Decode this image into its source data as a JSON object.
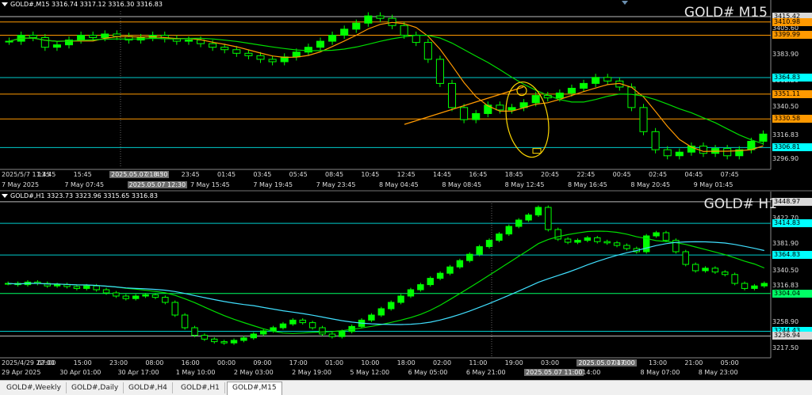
{
  "panels": [
    {
      "id": "m15",
      "info": "GOLD#,M15 3316.74 3317.12 3316.30 3316.83",
      "watermark": "GOLD# M15",
      "price_min": 3290,
      "price_max": 3420,
      "price_labels": [
        "3405.60",
        "3383.90",
        "3362.20",
        "3340.50",
        "3316.83",
        "3296.90"
      ],
      "tags": [
        {
          "value": "3415.42",
          "bg": "#d9d9d9",
          "fg": "#000"
        },
        {
          "value": "3410.98",
          "bg": "#ff9900",
          "fg": "#000"
        },
        {
          "value": "3399.99",
          "bg": "#ff9900",
          "fg": "#000"
        },
        {
          "value": "3364.83",
          "bg": "#00ffff",
          "fg": "#000"
        },
        {
          "value": "3351.11",
          "bg": "#ff9900",
          "fg": "#000"
        },
        {
          "value": "3330.58",
          "bg": "#ff9900",
          "fg": "#000"
        },
        {
          "value": "3306.81",
          "bg": "#00ffff",
          "fg": "#000"
        }
      ],
      "time_labels": [
        "2025/5/7 11:45",
        "13:45",
        "15:45",
        "2025.05.07 18:30",
        "21:45",
        "23:45",
        "01:45",
        "03:45",
        "05:45",
        "08:45",
        "10:45",
        "12:45",
        "14:45",
        "16:45",
        "18:45",
        "20:45",
        "22:45",
        "00:45",
        "02:45",
        "04:45",
        "07:45"
      ],
      "time_labels_2": [
        "7 May 2025",
        "7 May 07:45",
        "2025.05.07 12:30",
        "7 May 15:45",
        "7 May 19:45",
        "7 May 23:45",
        "8 May 04:45",
        "8 May 08:45",
        "8 May 12:45",
        "8 May 16:45",
        "8 May 20:45",
        "9 May 01:45"
      ],
      "price_series": [
        3395,
        3400,
        3398,
        3390,
        3392,
        3396,
        3400,
        3398,
        3401,
        3399,
        3396,
        3398,
        3400,
        3397,
        3395,
        3396,
        3393,
        3390,
        3388,
        3385,
        3383,
        3380,
        3378,
        3382,
        3386,
        3390,
        3395,
        3400,
        3405,
        3410,
        3416,
        3414,
        3408,
        3400,
        3394,
        3380,
        3360,
        3340,
        3330,
        3335,
        3342,
        3338,
        3340,
        3344,
        3350,
        3348,
        3352,
        3356,
        3360,
        3365,
        3362,
        3357,
        3340,
        3320,
        3305,
        3300,
        3303,
        3308,
        3302,
        3306,
        3300,
        3305,
        3312,
        3318
      ]
    },
    {
      "id": "h1",
      "info": "GOLD#,H1 3323.73 3323.96 3315.65 3316.83",
      "watermark": "GOLD# H1",
      "price_min": 3205,
      "price_max": 3450,
      "price_labels": [
        "3422.70",
        "3381.90",
        "3340.50",
        "3316.83",
        "3258.90",
        "3217.50"
      ],
      "tags": [
        {
          "value": "3448.97",
          "bg": "#d9d9d9",
          "fg": "#000"
        },
        {
          "value": "3414.83",
          "bg": "#00ffff",
          "fg": "#000"
        },
        {
          "value": "3364.83",
          "bg": "#00ffff",
          "fg": "#000"
        },
        {
          "value": "3304.04",
          "bg": "#00ff66",
          "fg": "#000"
        },
        {
          "value": "3244.43",
          "bg": "#00ffff",
          "fg": "#000"
        },
        {
          "value": "3236.94",
          "bg": "#d9d9d9",
          "fg": "#000"
        }
      ],
      "time_labels": [
        "2025/4/29 22:00",
        "07:00",
        "15:00",
        "23:00",
        "08:00",
        "16:00",
        "00:00",
        "09:00",
        "17:00",
        "01:00",
        "10:00",
        "18:00",
        "02:00",
        "11:00",
        "19:00",
        "03:00",
        "2025.05.07 17:00",
        "04:00",
        "13:00",
        "21:00",
        "05:00"
      ],
      "time_labels_2": [
        "29 Apr 2025",
        "30 Apr 01:00",
        "30 Apr 17:00",
        "1 May 10:00",
        "2 May 03:00",
        "2 May 19:00",
        "5 May 12:00",
        "6 May 05:00",
        "6 May 21:00",
        "2025.05.07 11:00",
        "14:00",
        "8 May 07:00",
        "8 May 23:00"
      ],
      "price_series": [
        3320,
        3318,
        3322,
        3320,
        3316,
        3318,
        3315,
        3312,
        3316,
        3310,
        3305,
        3300,
        3296,
        3300,
        3302,
        3298,
        3290,
        3270,
        3250,
        3238,
        3232,
        3228,
        3226,
        3230,
        3234,
        3240,
        3245,
        3250,
        3256,
        3262,
        3258,
        3250,
        3240,
        3236,
        3244,
        3252,
        3262,
        3270,
        3280,
        3290,
        3300,
        3310,
        3318,
        3328,
        3336,
        3346,
        3356,
        3366,
        3378,
        3388,
        3398,
        3410,
        3420,
        3428,
        3440,
        3405,
        3390,
        3385,
        3388,
        3392,
        3386,
        3384,
        3380,
        3375,
        3370,
        3395,
        3400,
        3388,
        3370,
        3350,
        3340,
        3344,
        3338,
        3334,
        3320,
        3312,
        3316,
        3320
      ]
    }
  ],
  "tabs": [
    "GOLD#,Weekly",
    "GOLD#,Daily",
    "GOLD#,H4",
    "GOLD#,H1",
    "GOLD#,M15"
  ],
  "active_tab": "GOLD#,M15",
  "colors": {
    "candle": "#00ff00",
    "ma_fast": "#ff9900",
    "ma_slow": "#00dd00",
    "ma_cyan": "#40e0ff",
    "level_cyan": "#00cccc",
    "level_orange": "#ff9900",
    "annotation": "#ffd700"
  }
}
